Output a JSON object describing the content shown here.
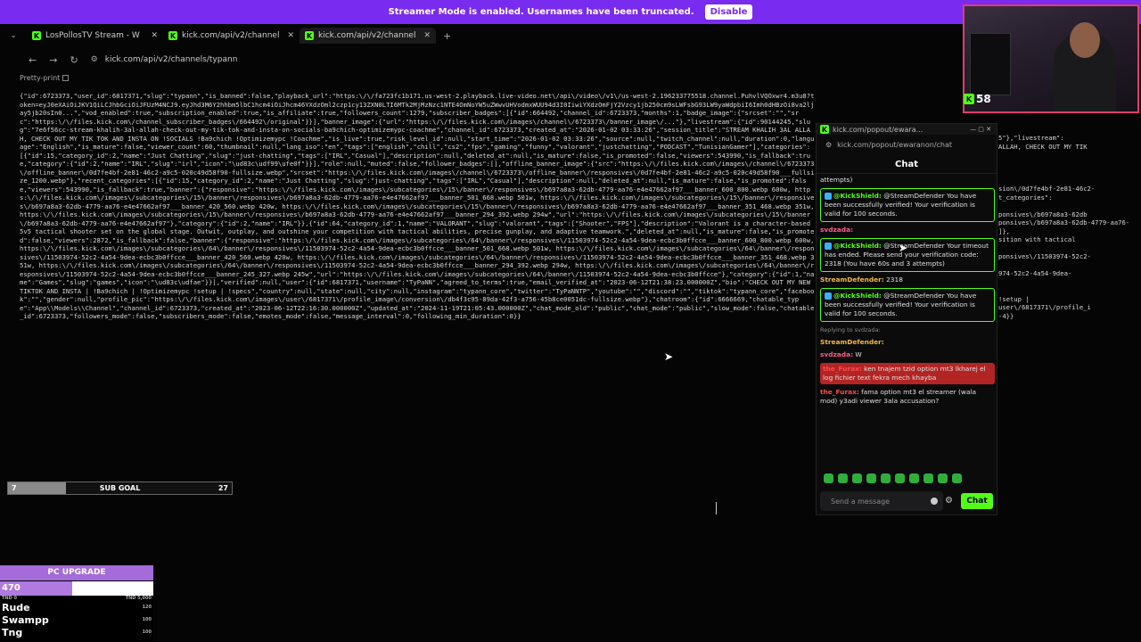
{
  "banner": {
    "text": "Streamer Mode is enabled. Usernames have been truncated.",
    "button": "Disable"
  },
  "tabs": [
    {
      "label": "LosPollosTV Stream - W"
    },
    {
      "label": "kick.com/api/v2/channel"
    },
    {
      "label": "kick.com/api/v2/channel"
    }
  ],
  "address": "kick.com/api/v2/channels/typann",
  "pretty_print": "Pretty-print",
  "json_text": "{\"id\":6723373,\"user_id\":6817371,\"slug\":\"typann\",\"is_banned\":false,\"playback_url\":\"https:\\/\\/fa723fc1b171.us-west-2.playback.live-video.net\\/api\\/video\\/v1\\/us-west-2.196233775518.channel.PuhvlVQOxwr4.m3u8?token=eyJ0eXAiOiJKV1QiLCJhbGciOiJFUzM4NCJ9.eyJhd3M6Y2hhbm5lbC1hcm4iOiJhcm46YXdzOml2czp1cy13ZXN0LTI6MTk2MjMzNzc1NTE4OmNoYW5uZWwvUHVodmxWUU94d3I0IiwiYXdzOmFjY2Vzcy1jb250cm9sLWFsbG93LW9yaWdpbiI6Imh0dHBzOi8va2ljay5jb20sIn0...\",\"vod_enabled\":true,\"subscription_enabled\":true,\"is_affiliate\":true,\"followers_count\":1279,\"subscriber_badges\":[{\"id\":664492,\"channel_id\":6723373,\"months\":1,\"badge_image\":{\"srcset\":\"\",\"src\":\"https:\\/\\/files.kick.com\\/channel_subscriber_badges\\/664492\\/original\"}}],\"banner_image\":{\"url\":\"https:\\/\\/files.kick.com\\/images\\/channel\\/6723373\\/banner_image\\/...\"},\"livestream\":{\"id\":90144245,\"slug\":\"7e6f56cc-stream-khalih-3al-allah-check-out-my-tik-tok-and-insta-on-socials-ba9chich-optimizemypc-coachme\",\"channel_id\":6723373,\"created_at\":\"2026-01-02 03:33:26\",\"session_title\":\"STREAM KHALIH 3AL ALLAH, CHECK OUT MY TIK TOK AND INSTA ON !SOCIALS !Ba9chich !Optimizemypc !Coachme\",\"is_live\":true,\"risk_level_id\":null,\"start_time\":\"2026-01-02 03:33:26\",\"source\":null,\"twitch_channel\":null,\"duration\":0,\"language\":\"English\",\"is_mature\":false,\"viewer_count\":60,\"thumbnail\":null,\"lang_iso\":\"en\",\"tags\":[\"english\",\"chill\",\"cs2\",\"fps\",\"gaming\",\"funny\",\"valorant\",\"justchatting\",\"PODCAST\",\"TunisianGamer\"],\"categories\":[{\"id\":15,\"category_id\":2,\"name\":\"Just Chatting\",\"slug\":\"just-chatting\",\"tags\":[\"IRL\",\"Casual\"],\"description\":null,\"deleted_at\":null,\"is_mature\":false,\"is_promoted\":false,\"viewers\":543990,\"is_fallback\":true,\"category\":{\"id\":2,\"name\":\"IRL\",\"slug\":\"irl\",\"icon\":\"\\ud83c\\udf99\\ufe0f\"}}],\"role\":null,\"muted\":false,\"follower_badges\":[],\"offline_banner_image\":{\"src\":\"https:\\/\\/files.kick.com\\/images\\/channel\\/6723373\\/offline_banner\\/0d7fe4bf-2e81-46c2-a9c5-020c49d58f90-fullsize.webp\",\"srcset\":\"https:\\/\\/files.kick.com\\/images\\/channel\\/6723373\\/offline_banner\\/responsives\\/0d7fe4bf-2e81-46c2-a9c5-020c49d58f90___fullsize_1200.webp\"},\"recent_categories\":[{\"id\":15,\"category_id\":2,\"name\":\"Just Chatting\",\"slug\":\"just-chatting\",\"tags\":[\"IRL\",\"Casual\"],\"description\":null,\"deleted_at\":null,\"is_mature\":false,\"is_promoted\":false,\"viewers\":543990,\"is_fallback\":true,\"banner\":{\"responsive\":\"https:\\/\\/files.kick.com\\/images\\/subcategories\\/15\\/banner\\/responsives\\/b697a8a3-62db-4779-aa76-e4e47662af97___banner_600_800.webp 600w, https:\\/\\/files.kick.com\\/images\\/subcategories\\/15\\/banner\\/responsives\\/b697a8a3-62db-4779-aa76-e4e47662af97___banner_501_668.webp 501w, https:\\/\\/files.kick.com\\/images\\/subcategories\\/15\\/banner\\/responsives\\/b697a8a3-62db-4779-aa76-e4e47662af97___banner_420_560.webp 420w, https:\\/\\/files.kick.com\\/images\\/subcategories\\/15\\/banner\\/responsives\\/b697a8a3-62db-4779-aa76-e4e47662af97___banner_351_468.webp 351w, https:\\/\\/files.kick.com\\/images\\/subcategories\\/15\\/banner\\/responsives\\/b697a8a3-62db-4779-aa76-e4e47662af97___banner_294_392.webp 294w\",\"url\":\"https:\\/\\/files.kick.com\\/images\\/subcategories\\/15\\/banner\\/b697a8a3-62db-4779-aa76-e4e47662af97\"},\"category\":{\"id\":2,\"name\":\"IRL\"}},{\"id\":64,\"category_id\":1,\"name\":\"VALORANT\",\"slug\":\"valorant\",\"tags\":[\"Shooter\",\"FPS\"],\"description\":\"Valorant is a character-based 5v5 tactical shooter set on the global stage. Outwit, outplay, and outshine your competition with tactical abilities, precise gunplay, and adaptive teamwork.\",\"deleted_at\":null,\"is_mature\":false,\"is_promoted\":false,\"viewers\":2872,\"is_fallback\":false,\"banner\":{\"responsive\":\"https:\\/\\/files.kick.com\\/images\\/subcategories\\/64\\/banner\\/responsives\\/11503974-52c2-4a54-9dea-ecbc3b0ffcce___banner_600_800.webp 600w, https:\\/\\/files.kick.com\\/images\\/subcategories\\/64\\/banner\\/responsives\\/11503974-52c2-4a54-9dea-ecbc3b0ffcce___banner_501_668.webp 501w, https:\\/\\/files.kick.com\\/images\\/subcategories\\/64\\/banner\\/responsives\\/11503974-52c2-4a54-9dea-ecbc3b0ffcce___banner_420_560.webp 420w, https:\\/\\/files.kick.com\\/images\\/subcategories\\/64\\/banner\\/responsives\\/11503974-52c2-4a54-9dea-ecbc3b0ffcce___banner_351_468.webp 351w, https:\\/\\/files.kick.com\\/images\\/subcategories\\/64\\/banner\\/responsives\\/11503974-52c2-4a54-9dea-ecbc3b0ffcce___banner_294_392.webp 294w, https:\\/\\/files.kick.com\\/images\\/subcategories\\/64\\/banner\\/responsives\\/11503974-52c2-4a54-9dea-ecbc3b0ffcce___banner_245_327.webp 245w\",\"url\":\"https:\\/\\/files.kick.com\\/images\\/subcategories\\/64\\/banner\\/11503974-52c2-4a54-9dea-ecbc3b0ffcce\"},\"category\":{\"id\":1,\"name\":\"Games\",\"slug\":\"games\",\"icon\":\"\\ud83c\\udfae\"}}],\"verified\":null,\"user\":{\"id\":6817371,\"username\":\"TyPaNN\",\"agreed_to_terms\":true,\"email_verified_at\":\"2023-06-12T21:38:23.000000Z\",\"bio\":\"CHECK OUT MY NEW TIKTOK AND INSTA | !Ba9chich | !Optimizemypc !setup | !specs\",\"country\":null,\"state\":null,\"city\":null,\"instagram\":\"typann_core\",\"twitter\":\"TyPaNNTP\",\"youtube\":\"\",\"discord\":\"\",\"tiktok\":\"typann_core\",\"facebook\":\"\",\"gender\":null,\"profile_pic\":\"https:\\/\\/files.kick.com\\/images\\/user\\/6817371\\/profile_image\\/conversion\\/db4f3c95-89da-42f3-a756-45b8ce0051dc-fullsize.webp\"},\"chatroom\":{\"id\":6666669,\"chatable_type\":\"App\\\\Models\\\\Channel\",\"channel_id\":6723373,\"created_at\":\"2023-06-12T22:16:30.000000Z\",\"updated_at\":\"2024-11-19T21:05:43.000000Z\",\"chat_mode_old\":\"public\",\"chat_mode\":\"public\",\"slow_mode\":false,\"chatable_id\":6723373,\"followers_mode\":false,\"subscribers_mode\":false,\"emotes_mode\":false,\"message_interval\":0,\"following_min_duration\":0}}",
  "json_right": "5\"},\"livestream\":\nALLAH, CHECK OUT MY TIK\n\n\n\n\nsion\\/0d7fe4bf-2e81-46c2-\nt_categories\":\n\nponsives\\/b697a8a3-62db\nponsives\\/b697a8a3-62db-4779-aa76-\n]},\nsition with tactical\n\nponsives\\/11503974-52c2-\n\n974-52c2-4a54-9dea-\n\n\n!setup |\nuser\\/6817371\\/profile_i\n-4}}",
  "webcam": {
    "viewers": "58"
  },
  "chat_popup": {
    "window_title": "kick.com/popout/ewara...",
    "url": "kick.com/popout/ewaranon/chat",
    "heading": "Chat",
    "messages": [
      {
        "user": "",
        "text": "attempts)",
        "style": "plain"
      },
      {
        "user": "@KickShield:",
        "text": "@StreamDefender You have been successfully verified! Your verification is valid for 100 seconds.",
        "style": "boxed"
      },
      {
        "user": "svdzada:",
        "text": "",
        "style": "plain",
        "color": "#ff5c8a"
      },
      {
        "user": "@KickShield:",
        "text": "@StreamDefender Your timeout has ended. Please send your verification code: 2318 (You have 60s and 3 attempts)",
        "style": "boxed"
      },
      {
        "user": "StreamDefender:",
        "text": "2318",
        "style": "plain",
        "color": "#f2b84b"
      },
      {
        "user": "@KickShield:",
        "text": "@StreamDefender You have been successfully verified! Your verification is valid for 100 seconds.",
        "style": "boxed"
      },
      {
        "user": "",
        "text": "Replying to svdzada:",
        "style": "reply"
      },
      {
        "user": "StreamDefender:",
        "text": "",
        "style": "plain",
        "color": "#f2b84b"
      },
      {
        "user": "svdzada:",
        "text": "W",
        "style": "plain",
        "color": "#ff5c8a"
      },
      {
        "user": "the_Furax:",
        "text": "ken tnajem tzid option mt3 lkharej el log fichier text fekra mech khayba",
        "style": "red",
        "color": "#ff4a4a"
      },
      {
        "user": "the_Furax:",
        "text": "fama option mt3 el streamer (wala mod) y3adi viewer 3ala accusation?",
        "style": "plain",
        "color": "#ff4a4a"
      }
    ],
    "input_placeholder": "Send a message",
    "send_button": "Chat"
  },
  "sub_goal": {
    "current": "7",
    "label": "SUB GOAL",
    "target": "27",
    "progress": 0.26
  },
  "pc_upgrade": {
    "title": "PC UPGRADE",
    "value": "470",
    "progress": 0.47,
    "scale_min": "TND 0",
    "scale_max": "TND 5,000",
    "donors": [
      {
        "name": "Rude",
        "amount": "120"
      },
      {
        "name": "Swampp",
        "amount": "100"
      },
      {
        "name": "Tng",
        "amount": "100"
      }
    ]
  },
  "colors": {
    "kick_green": "#53fc18",
    "streamer_purple": "#7a2bf0",
    "bar_purple": "#a56bd8"
  }
}
